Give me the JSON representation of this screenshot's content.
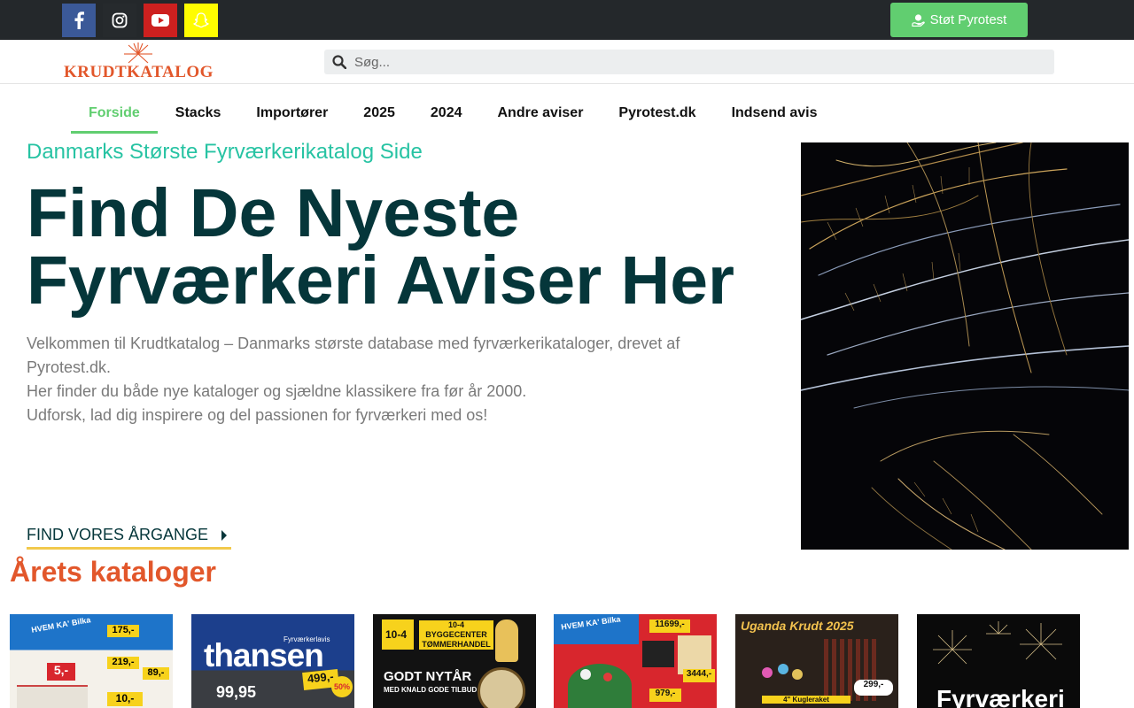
{
  "topbar": {
    "social": [
      {
        "name": "facebook-icon",
        "color": "#3b5998"
      },
      {
        "name": "instagram-icon",
        "color": "#262a2d"
      },
      {
        "name": "youtube-icon",
        "color": "#cd201f"
      },
      {
        "name": "snapchat-icon",
        "color": "#fffc00"
      }
    ],
    "donate_label": "Støt Pyrotest",
    "accent": "#61ce70"
  },
  "header": {
    "logo_text": "KRUDTKATALOG",
    "search": {
      "placeholder": "Søg...",
      "value": ""
    }
  },
  "nav": {
    "items": [
      {
        "label": "Forside",
        "active": true
      },
      {
        "label": "Stacks"
      },
      {
        "label": "Importører"
      },
      {
        "label": "2025"
      },
      {
        "label": "2024"
      },
      {
        "label": "Andre aviser"
      },
      {
        "label": "Pyrotest.dk"
      },
      {
        "label": "Indsend avis"
      }
    ]
  },
  "hero": {
    "eyebrow": "Danmarks Største Fyrværkerikatalog Side",
    "headline_line1": "Find De Nyeste",
    "headline_line2": "Fyrværkeri Aviser Her",
    "intro": [
      "Velkommen til Krudtkatalog – Danmarks største database med fyrværkerikataloger, drevet af Pyrotest.dk.",
      "Her finder du både nye kataloger og sjældne klassikere fra før år 2000.",
      "Udforsk, lad dig inspirere og del passionen for fyrværkeri med os!"
    ],
    "cta_label": "FIND VORES ÅRGANGE"
  },
  "catalogs": {
    "title": "Årets kataloger",
    "items": [
      {
        "brand": "HVEM KA' Bilka",
        "prices": [
          "175,-",
          "219,-",
          "89,-",
          "5,-",
          "10,-"
        ]
      },
      {
        "brand": "thansen",
        "subtitle": "Fyrværkerlavis",
        "prices": [
          "499,-",
          "99,95"
        ],
        "badge": "50%"
      },
      {
        "brand": "10-4 BYGGECENTER TØMMERHANDEL",
        "headline": "GODT NYTÅR",
        "sub": "MED KNALD GODE TILBUD"
      },
      {
        "brand": "HVEM KA' Bilka",
        "prices": [
          "11699,-",
          "3444,-",
          "979,-"
        ]
      },
      {
        "brand": "Uganda Krudt 2025",
        "prices": [
          "299,-"
        ],
        "note": "4\" Kugleraket"
      },
      {
        "brand": "Fyrværkeri"
      }
    ]
  }
}
